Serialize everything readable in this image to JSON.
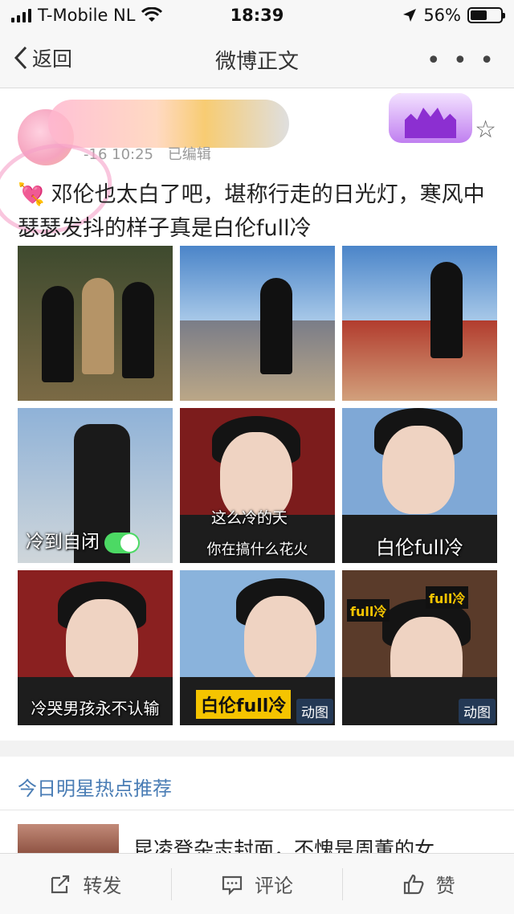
{
  "status_bar": {
    "carrier": "T-Mobile NL",
    "time": "18:39",
    "battery_text": "56%",
    "battery_level": 0.56
  },
  "nav": {
    "back_label": "返回",
    "title": "微博正文",
    "more": "• • •"
  },
  "post": {
    "meta_time": "-16 10:25",
    "meta_edited": "已编辑",
    "text": "邓伦也太白了吧，堪称行走的日光灯，寒风中瑟瑟发抖的样子真是白伦full冷",
    "heart_emoji": "💘",
    "images": [
      {
        "caption": "",
        "badge": ""
      },
      {
        "caption": "",
        "badge": ""
      },
      {
        "caption": "",
        "badge": ""
      },
      {
        "caption": "冷到自闭",
        "badge": ""
      },
      {
        "caption": "这么冷的天",
        "caption2": "你在搞什么花火",
        "badge": ""
      },
      {
        "caption": "白伦full冷",
        "badge": ""
      },
      {
        "caption": "冷哭男孩永不认输",
        "badge": ""
      },
      {
        "caption": "白伦full冷",
        "badge": "动图"
      },
      {
        "caption": "full冷",
        "caption2": "full冷",
        "badge": "动图"
      }
    ]
  },
  "recommend": {
    "title": "今日明星热点推荐",
    "item_text": "昆凌登杂志封面，不愧是周董的女"
  },
  "toolbar": {
    "repost": "转发",
    "comment": "评论",
    "like": "赞"
  },
  "colors": {
    "link_blue": "#4a7db5",
    "toggle_green": "#4cd964"
  }
}
